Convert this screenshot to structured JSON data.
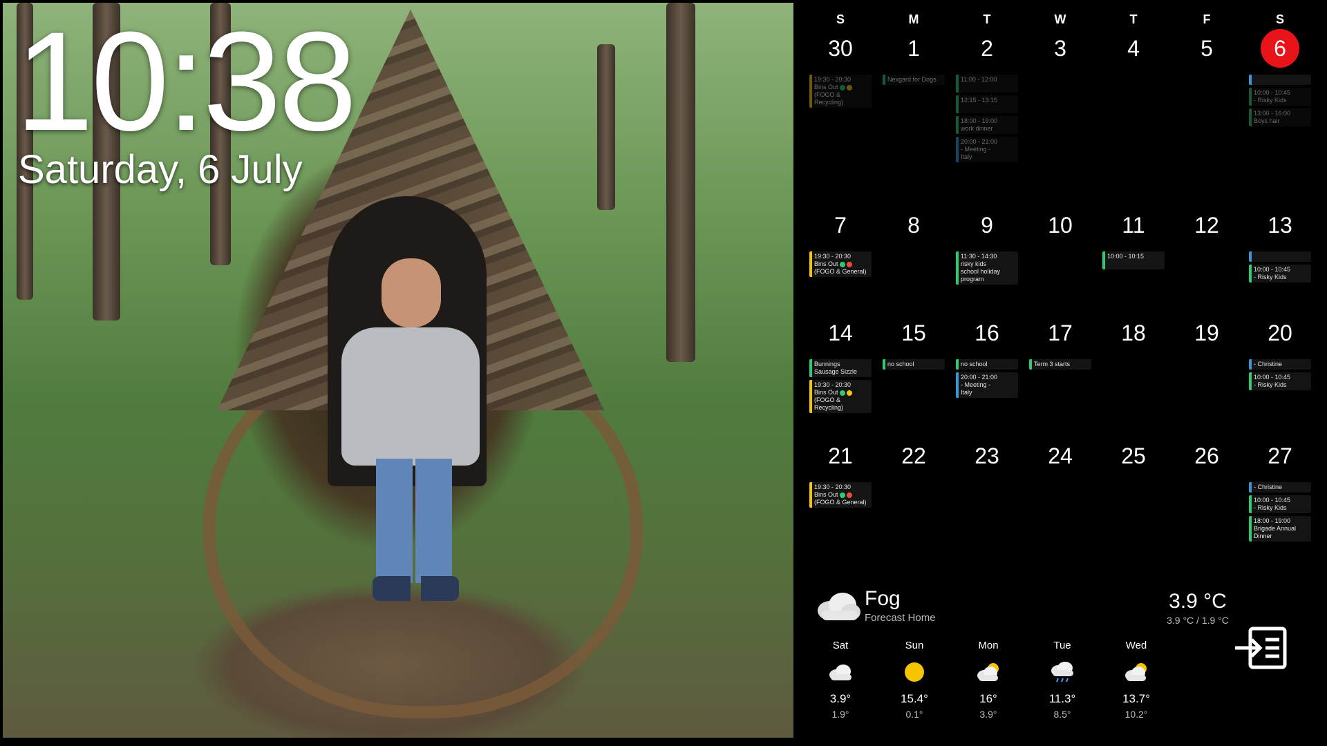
{
  "clock": {
    "time": "10:38",
    "date": "Saturday, 6 July"
  },
  "calendar": {
    "weekdays": [
      "S",
      "M",
      "T",
      "W",
      "T",
      "F",
      "S"
    ],
    "weeks": [
      [
        {
          "day": "30",
          "events": [
            {
              "time": "19:30 - 20:30",
              "text": "Bins Out",
              "sub": "(FOGO & Recycling)",
              "dots": [
                "#2ecc71",
                "#f1c40f"
              ],
              "color": "#f1c40f",
              "past": true
            }
          ]
        },
        {
          "day": "1",
          "events": [
            {
              "time": "",
              "text": "Nexgard for Dogs",
              "sub": "",
              "dots": [],
              "color": "#2ecc71",
              "past": true
            }
          ]
        },
        {
          "day": "2",
          "events": [
            {
              "time": "11:00 - 12:00",
              "text": "",
              "sub": "",
              "dots": [],
              "color": "#2ecc71",
              "past": true
            },
            {
              "time": "12:15 - 13:15",
              "text": "",
              "sub": "",
              "dots": [],
              "color": "#2ecc71",
              "past": true
            },
            {
              "time": "18:00 - 19:00",
              "text": "work dinner",
              "sub": "",
              "dots": [],
              "color": "#2ecc71",
              "past": true
            },
            {
              "time": "20:00 - 21:00",
              "text": "- Meeting -",
              "sub": "Italy",
              "dots": [],
              "color": "#3498db",
              "past": true
            }
          ]
        },
        {
          "day": "3",
          "events": []
        },
        {
          "day": "4",
          "events": []
        },
        {
          "day": "5",
          "events": []
        },
        {
          "day": "6",
          "today": true,
          "events": [
            {
              "time": "",
              "text": "",
              "sub": "",
              "dots": [],
              "color": "#3498db",
              "past": false
            },
            {
              "time": "10:00 - 10:45",
              "text": "- Risky Kids",
              "sub": "",
              "dots": [],
              "color": "#2ecc71",
              "past": true
            },
            {
              "time": "13:00 - 16:00",
              "text": "Boys hair",
              "sub": "",
              "dots": [],
              "color": "#2ecc71",
              "past": true
            }
          ]
        }
      ],
      [
        {
          "day": "7",
          "events": [
            {
              "time": "19:30 - 20:30",
              "text": "Bins Out",
              "sub": "(FOGO & General)",
              "dots": [
                "#2ecc71",
                "#e74c3c"
              ],
              "color": "#f1c40f"
            }
          ]
        },
        {
          "day": "8",
          "events": []
        },
        {
          "day": "9",
          "events": [
            {
              "time": "11:30 - 14:30",
              "text": "risky kids",
              "sub": "school holiday program",
              "dots": [],
              "color": "#2ecc71"
            }
          ]
        },
        {
          "day": "10",
          "events": []
        },
        {
          "day": "11",
          "events": [
            {
              "time": "10:00 - 10:15",
              "text": "",
              "sub": "",
              "dots": [],
              "color": "#2ecc71"
            }
          ]
        },
        {
          "day": "12",
          "events": []
        },
        {
          "day": "13",
          "events": [
            {
              "time": "",
              "text": "",
              "sub": "",
              "dots": [],
              "color": "#3498db"
            },
            {
              "time": "10:00 - 10:45",
              "text": "- Risky Kids",
              "sub": "",
              "dots": [],
              "color": "#2ecc71"
            }
          ]
        }
      ],
      [
        {
          "day": "14",
          "events": [
            {
              "time": "",
              "text": "Bunnings",
              "sub": "Sausage Sizzle",
              "dots": [],
              "color": "#2ecc71"
            },
            {
              "time": "19:30 - 20:30",
              "text": "Bins Out",
              "sub": "(FOGO & Recycling)",
              "dots": [
                "#2ecc71",
                "#f1c40f"
              ],
              "color": "#f1c40f"
            }
          ]
        },
        {
          "day": "15",
          "events": [
            {
              "time": "",
              "text": "no school",
              "sub": "",
              "dots": [],
              "color": "#2ecc71"
            }
          ]
        },
        {
          "day": "16",
          "events": [
            {
              "time": "",
              "text": "no school",
              "sub": "",
              "dots": [],
              "color": "#2ecc71"
            },
            {
              "time": "20:00 - 21:00",
              "text": "- Meeting -",
              "sub": "Italy",
              "dots": [],
              "color": "#3498db"
            }
          ]
        },
        {
          "day": "17",
          "events": [
            {
              "time": "",
              "text": "Term 3 starts",
              "sub": "",
              "dots": [],
              "color": "#2ecc71"
            }
          ]
        },
        {
          "day": "18",
          "events": []
        },
        {
          "day": "19",
          "events": []
        },
        {
          "day": "20",
          "events": [
            {
              "time": "",
              "text": "- Christine",
              "sub": "",
              "dots": [],
              "color": "#3498db"
            },
            {
              "time": "10:00 - 10:45",
              "text": "- Risky Kids",
              "sub": "",
              "dots": [],
              "color": "#2ecc71"
            }
          ]
        }
      ],
      [
        {
          "day": "21",
          "events": [
            {
              "time": "19:30 - 20:30",
              "text": "Bins Out",
              "sub": "(FOGO & General)",
              "dots": [
                "#2ecc71",
                "#e74c3c"
              ],
              "color": "#f1c40f"
            }
          ]
        },
        {
          "day": "22",
          "events": []
        },
        {
          "day": "23",
          "events": []
        },
        {
          "day": "24",
          "events": []
        },
        {
          "day": "25",
          "events": []
        },
        {
          "day": "26",
          "events": []
        },
        {
          "day": "27",
          "events": [
            {
              "time": "",
              "text": "- Christine",
              "sub": "",
              "dots": [],
              "color": "#3498db"
            },
            {
              "time": "10:00 - 10:45",
              "text": "- Risky Kids",
              "sub": "",
              "dots": [],
              "color": "#2ecc71"
            },
            {
              "time": "18:00 - 19:00",
              "text": "Brigade Annual",
              "sub": "Dinner",
              "dots": [],
              "color": "#2ecc71"
            }
          ]
        }
      ]
    ]
  },
  "weather": {
    "condition": "Fog",
    "location": "Forecast Home",
    "current_temp": "3.9 °C",
    "range": "3.9 °C / 1.9 °C",
    "forecast": [
      {
        "day": "Sat",
        "icon": "cloudy",
        "high": "3.9°",
        "low": "1.9°"
      },
      {
        "day": "Sun",
        "icon": "sunny",
        "high": "15.4°",
        "low": "0.1°"
      },
      {
        "day": "Mon",
        "icon": "partly-cloudy",
        "high": "16°",
        "low": "3.9°"
      },
      {
        "day": "Tue",
        "icon": "rainy",
        "high": "11.3°",
        "low": "8.5°"
      },
      {
        "day": "Wed",
        "icon": "partly-cloudy",
        "high": "13.7°",
        "low": "10.2°"
      }
    ]
  },
  "colors": {
    "today": "#e8141a",
    "background": "#000000"
  }
}
